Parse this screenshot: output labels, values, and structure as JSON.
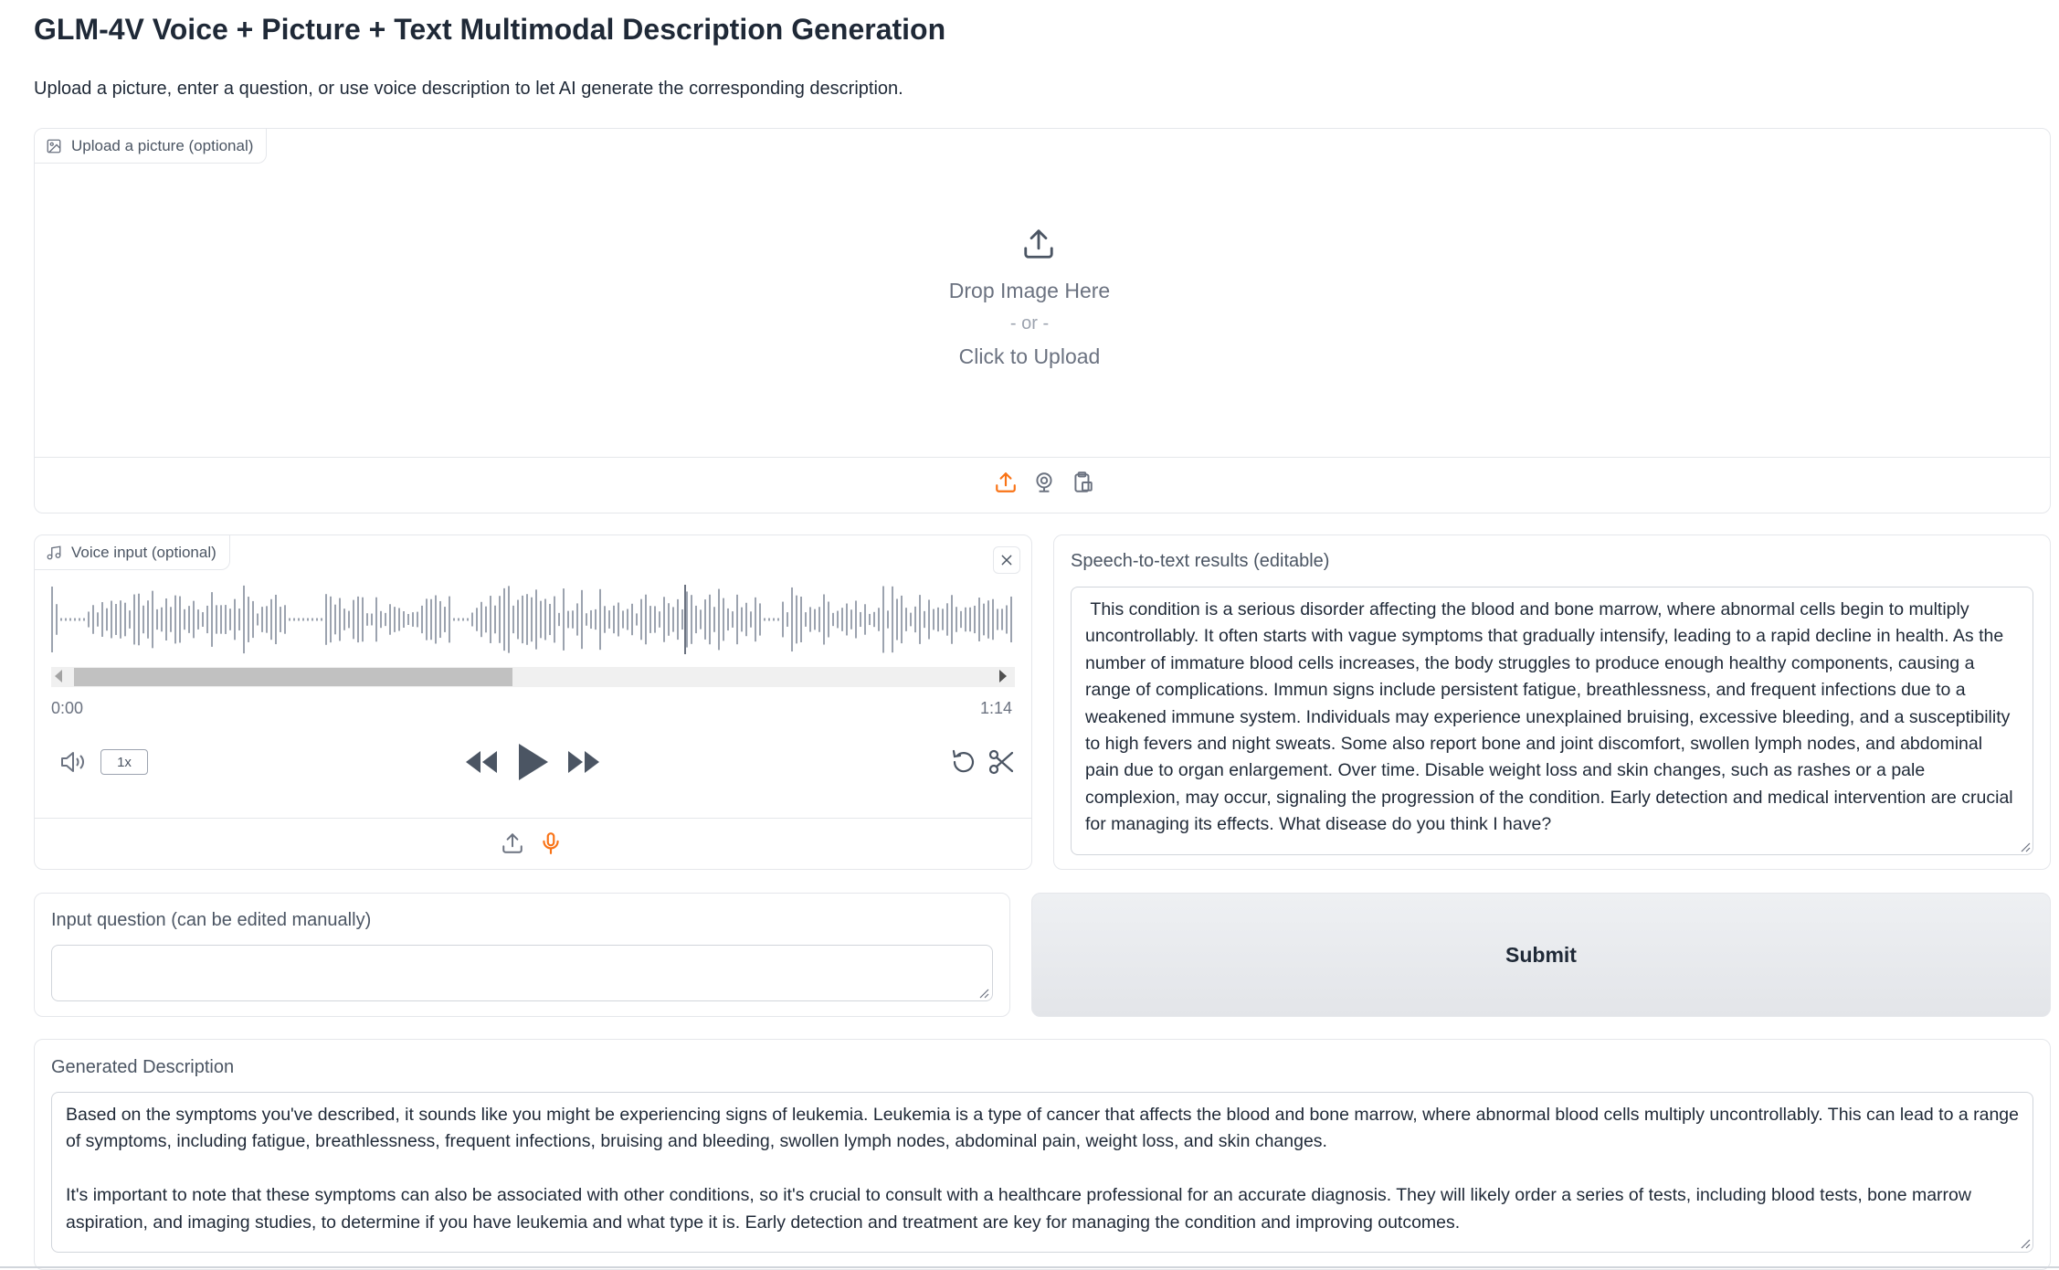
{
  "page": {
    "title": "GLM-4V Voice + Picture + Text Multimodal Description Generation",
    "subtitle": "Upload a picture, enter a question, or use voice description to let AI generate the corresponding description."
  },
  "image_upload": {
    "label": "Upload a picture (optional)",
    "drop_text": "Drop Image Here",
    "or_text": "- or -",
    "click_text": "Click to Upload",
    "sources": [
      "upload-icon",
      "webcam-icon",
      "clipboard-icon"
    ],
    "active_source_color": "#f97316"
  },
  "voice_input": {
    "label": "Voice input (optional)",
    "time_current": "0:00",
    "time_total": "1:14",
    "playback_rate": "1x",
    "sources": [
      "upload-icon",
      "microphone-icon"
    ]
  },
  "speech_to_text": {
    "label": "Speech-to-text results (editable)",
    "value": " This condition is a serious disorder affecting the blood and bone marrow, where abnormal cells begin to multiply uncontrollably. It often starts with vague symptoms that gradually intensify, leading to a rapid decline in health. As the number of immature blood cells increases, the body struggles to produce enough healthy components, causing a range of complications. Immun signs include persistent fatigue, breathlessness, and frequent infections due to a weakened immune system. Individuals may experience unexplained bruising, excessive bleeding, and a susceptibility to high fevers and night sweats. Some also report bone and joint discomfort, swollen lymph nodes, and abdominal pain due to organ enlargement. Over time. Disable weight loss and skin changes, such as rashes or a pale complexion, may occur, signaling the progression of the condition. Early detection and medical intervention are crucial for managing its effects. What disease do you think I have?"
  },
  "question": {
    "label": "Input question (can be edited manually)",
    "value": ""
  },
  "submit": {
    "label": "Submit"
  },
  "description": {
    "label": "Generated Description",
    "value": "Based on the symptoms you've described, it sounds like you might be experiencing signs of leukemia. Leukemia is a type of cancer that affects the blood and bone marrow, where abnormal blood cells multiply uncontrollably. This can lead to a range of symptoms, including fatigue, breathlessness, frequent infections, bruising and bleeding, swollen lymph nodes, abdominal pain, weight loss, and skin changes.\n\nIt's important to note that these symptoms can also be associated with other conditions, so it's crucial to consult with a healthcare professional for an accurate diagnosis. They will likely order a series of tests, including blood tests, bone marrow aspiration, and imaging studies, to determine if you have leukemia and what type it is. Early detection and treatment are key for managing the condition and improving outcomes."
  }
}
